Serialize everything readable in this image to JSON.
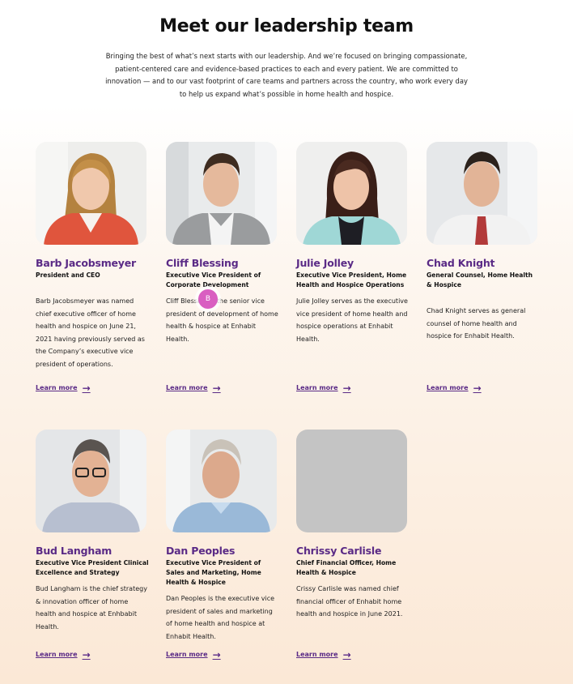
{
  "section": {
    "title": "Meet our leadership team",
    "intro": "Bringing the best of what’s next starts with our leadership. And we’re focused on bringing compassionate, patient-centered care and evidence-based practices to each and every patient. We are committed to innovation — and to our vast footprint of care teams and partners across the country, who work every day to help us expand what’s possible in home health and hospice."
  },
  "leaders": [
    {
      "name": "Barb Jacobsmeyer",
      "role": "President and CEO",
      "bio": "Barb Jacobsmeyer was named chief executive officer of home health and hospice on June 21, 2021 having previously served as the Company’s executive vice president of operations.",
      "link": "Learn more"
    },
    {
      "name": "Cliff Blessing",
      "role": "Executive Vice President of Corporate Development",
      "bio": "Cliff Blessing is the senior vice president of development of home health & hospice at Enhabit Health.",
      "link": "Learn more"
    },
    {
      "name": "Julie Jolley",
      "role": "Executive Vice President, Home Health and Hospice Operations",
      "bio": "Julie Jolley serves as the executive vice president of home health and hospice operations at Enhabit Health.",
      "link": "Learn more"
    },
    {
      "name": "Chad Knight",
      "role": "General Counsel, Home Health & Hospice",
      "bio": "Chad Knight serves as general counsel of home health and hospice for Enhabit Health.",
      "link": "Learn more"
    },
    {
      "name": "Bud Langham",
      "role": "Executive Vice President Clinical Excellence and Strategy",
      "bio": "Bud Langham is the chief strategy & innovation officer of home health and hospice at Enhbabit Health.",
      "link": "Learn more"
    },
    {
      "name": "Dan Peoples",
      "role": "Executive Vice President of Sales and Marketing, Home Health & Hospice",
      "bio": "Dan Peoples is the executive vice president of sales and marketing of home health and hospice at Enhabit Health.",
      "link": "Learn more"
    },
    {
      "name": "Chrissy Carlisle",
      "role": "Chief Financial Officer, Home Health & Hospice",
      "bio": "Crissy Carlisle was named chief financial officer of Enhabit home health and hospice in June 2021.",
      "link": "Learn more"
    }
  ],
  "cursor": {
    "label": "B"
  },
  "colors": {
    "accent": "#5a2a86",
    "placeholder": "#c4c4c4",
    "cursor": "#d95fc1"
  }
}
